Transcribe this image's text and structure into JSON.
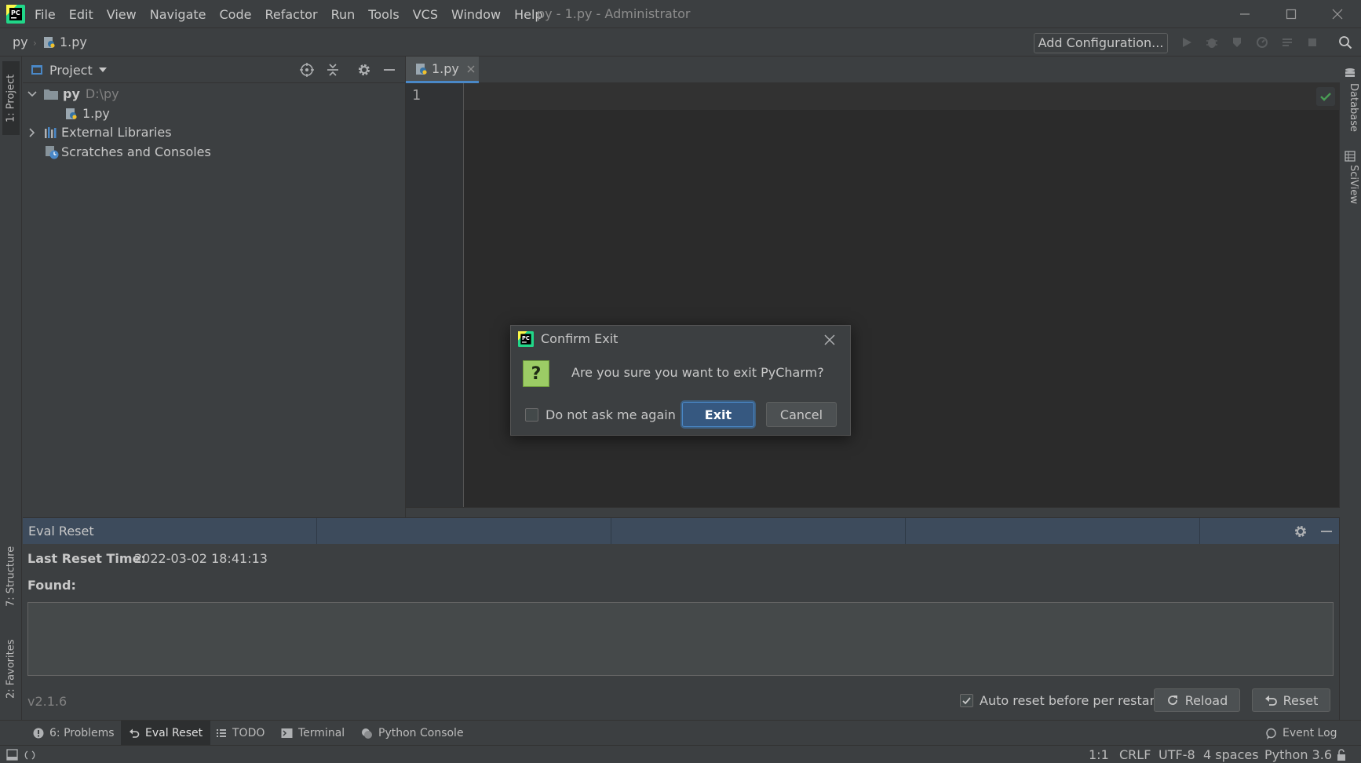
{
  "menu": [
    "File",
    "Edit",
    "View",
    "Navigate",
    "Code",
    "Refactor",
    "Run",
    "Tools",
    "VCS",
    "Window",
    "Help"
  ],
  "window_title": "py - 1.py - Administrator",
  "navbar": {
    "project": "py",
    "file": "1.py",
    "add_config": "Add Configuration..."
  },
  "left_stripe": {
    "project": "1: Project",
    "structure": "7: Structure",
    "favorites": "2: Favorites"
  },
  "right_stripe": {
    "database": "Database",
    "sciview": "SciView"
  },
  "project_panel": {
    "title": "Project",
    "tree": {
      "root_name": "py",
      "root_path": "D:\\py",
      "file": "1.py",
      "external_libraries": "External Libraries",
      "scratches": "Scratches and Consoles"
    }
  },
  "editor": {
    "tab": "1.py",
    "line_number": "1"
  },
  "eval_panel": {
    "title": "Eval Reset",
    "last_reset_label": "Last Reset Time:",
    "last_reset_value": "2022-03-02 18:41:13",
    "found_label": "Found:",
    "version": "v2.1.6",
    "auto_reset_label": "Auto reset before per restart",
    "auto_reset_checked": true,
    "reload_label": "Reload",
    "reset_label": "Reset"
  },
  "tool_tabs": {
    "problems": "6: Problems",
    "eval_reset": "Eval Reset",
    "todo": "TODO",
    "terminal": "Terminal",
    "python_console": "Python Console",
    "event_log": "Event Log"
  },
  "status_bar": {
    "position": "1:1",
    "line_sep": "CRLF",
    "encoding": "UTF-8",
    "indent": "4 spaces",
    "interpreter": "Python 3.6"
  },
  "dialog": {
    "title": "Confirm Exit",
    "message": "Are you sure you want to exit PyCharm?",
    "dont_ask_label": "Do not ask me again",
    "exit_label": "Exit",
    "cancel_label": "Cancel",
    "question_glyph": "?"
  },
  "colors": {
    "accent": "#4a88c7",
    "check_green": "#499c54",
    "logo_green": "#21d789",
    "question_green": "#9ccc65"
  }
}
